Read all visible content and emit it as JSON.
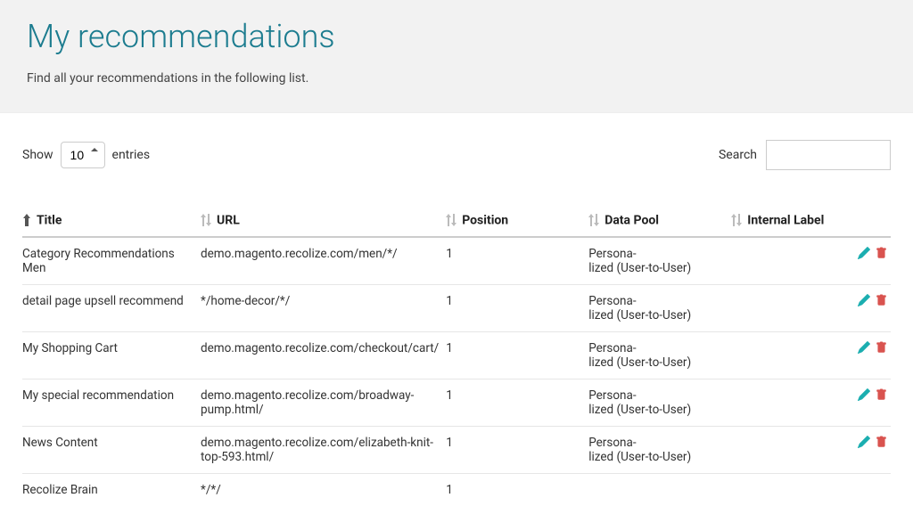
{
  "header": {
    "title": "My recommendations",
    "subtitle": "Find all your recommendations in the following list."
  },
  "controls": {
    "show_label": "Show",
    "entries_label": "entries",
    "page_length_value": "10",
    "search_label": "Search",
    "search_value": ""
  },
  "table": {
    "columns": {
      "title": "Title",
      "url": "URL",
      "position": "Position",
      "data_pool": "Data Pool",
      "internal_label": "Internal Label"
    },
    "rows": [
      {
        "title": "Category Recommendations Men",
        "url": "demo.magento.recolize.com/men/*/",
        "position": "1",
        "data_pool": "Persona-\nlized (User-to-User)",
        "internal_label": "",
        "has_actions": true
      },
      {
        "title": "detail page upsell recommend",
        "url": "*/home-decor/*/",
        "position": "1",
        "data_pool": "Persona-\nlized (User-to-User)",
        "internal_label": "",
        "has_actions": true
      },
      {
        "title": "My Shopping Cart",
        "url": "demo.magento.recolize.com/checkout/cart/",
        "position": "1",
        "data_pool": "Persona-\nlized (User-to-User)",
        "internal_label": "",
        "has_actions": true
      },
      {
        "title": "My special recommendation",
        "url": "demo.magento.recolize.com/broadway-pump.html/",
        "position": "1",
        "data_pool": "Persona-\nlized (User-to-User)",
        "internal_label": "",
        "has_actions": true
      },
      {
        "title": "News Content",
        "url": "demo.magento.recolize.com/elizabeth-knit-top-593.html/",
        "position": "1",
        "data_pool": "Persona-\nlized (User-to-User)",
        "internal_label": "",
        "has_actions": true
      },
      {
        "title": "Recolize Brain",
        "url": "*/*/",
        "position": "1",
        "data_pool": "",
        "internal_label": "",
        "has_actions": false
      }
    ]
  }
}
